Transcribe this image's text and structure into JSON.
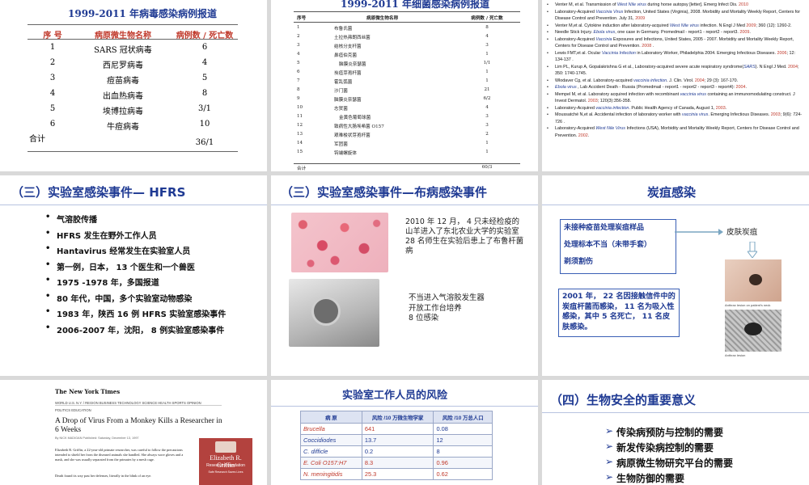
{
  "slide1": {
    "title": "1999-2011 年病毒感染病例报道",
    "headers": [
      "序 号",
      "病原微生物名称",
      "病例数 / 死亡数"
    ],
    "rows": [
      [
        "1",
        "SARS 冠状病毒",
        "6"
      ],
      [
        "2",
        "西尼罗病毒",
        "4"
      ],
      [
        "3",
        "痘苗病毒",
        "5"
      ],
      [
        "4",
        "出血热病毒",
        "8"
      ],
      [
        "5",
        "埃博拉病毒",
        "3/1"
      ],
      [
        "6",
        "牛痘病毒",
        "10"
      ]
    ],
    "total_label": "合计",
    "total_value": "36/1"
  },
  "slide2": {
    "title": "1999-2011 年细菌感染病例报道",
    "headers": [
      "序号",
      "病原微生物名称",
      "病例数 / 死亡数"
    ],
    "rows": [
      [
        "1",
        "布鲁氏菌",
        "8"
      ],
      [
        "2",
        "土拉热弗朗西丝菌",
        "4"
      ],
      [
        "3",
        "结核分支杆菌",
        "3"
      ],
      [
        "4",
        "鼻疽伯克菌",
        "1"
      ],
      [
        "5",
        "脑膜炎奈瑟菌",
        "1/1"
      ],
      [
        "6",
        "炭疽芽孢杆菌",
        "1"
      ],
      [
        "7",
        "霍乱弧菌",
        "1"
      ],
      [
        "8",
        "沙门菌",
        "21"
      ],
      [
        "9",
        "脑膜炎奈瑟菌",
        "6/2"
      ],
      [
        "10",
        "志贺菌",
        "4"
      ],
      [
        "11",
        "金黄色葡萄球菌",
        "3"
      ],
      [
        "12",
        "致病性大肠埃希菌 O157",
        "3"
      ],
      [
        "13",
        "艰难梭状芽孢杆菌",
        "2"
      ],
      [
        "14",
        "军团菌",
        "1"
      ],
      [
        "15",
        "钩端螺旋体",
        "1"
      ]
    ],
    "total_label": "合计",
    "total_value": "60/3"
  },
  "slide3": {
    "refs": [
      "Venter M, et al. Transmission of West Nile virus during horse autopsy [letter]. Emerg Infect Dis. 2010",
      "Laboratory-Acquired Vaccinia Virus Infection, United States (Virginia), 2008. Morbidity and Mortality Weekly Report, Centers for Disease Control and Prevention. July 31, 2009",
      "Venter M,et al. Cytokine induction after laboratory-acquired West Nile virus infection. N Engl J Med 2009; 360 (12): 1260-2.",
      "Needle Stick Injury. Ebola virus, one case in Germany. Promedmail - report1 - report2 - report3. 2009.",
      "Laboratory-Acquired Vaccinia Exposures and Infections, United States, 2005 - 2007. Morbidity and Mortality Weekly Report, Centers for Disease Control and Prevention. 2008 .",
      "Lewis FMT,et al. Ocular Vaccinia Infection in Laboratory Worker, Philadelphia 2004. Emerging Infectious Diseases. 2006; 12: 134-137 .",
      "Lim PL, Kurup A, Gopalakrishna G et al., Laboratory-acquired severe acute respiratory syndrome(SARS). N Engl J Med. 2004; 350: 1740-1745.",
      "Wlodaver Cg, et al. Laboratory-acquired vaccinia infection. J. Clin. Virol. 2004; 29 (3): 167-170.",
      "Ebola virus , Lab Accident Death - Russia (Promedmail - report1 - report2 - report3 - report4): 2004.",
      "Mempel M, et al. Laboratory acquired infection with recombinant vaccinia virus containing an immunomodulating construct. J Invest Dermatol. 2003; 120(3):356-358.",
      "Laboratory-Acquired vaccinia infection. Public Health Agency of Canada, August 1, 2003.",
      "Moussatché N,et al. Accidental infection of laboratory worker with vaccinia virus. Emerging Infectious Diseases. 2003; 9(6): 724-726 .",
      "Laboratory-Acquired West Nile Virus Infections (USA), Morbidity and Mortality Weekly Report, Centers for Disease Control and Prevention. 2002."
    ]
  },
  "slide4": {
    "title": "（三）实验室感染事件— HFRS",
    "bullets": [
      "气溶胶传播",
      "HFRS  发生在野外工作人员",
      "Hantavirus  经常发生在实验室人员",
      "第一例，日本， 13 个医生和一个兽医",
      "1975 -1978 年，多国报道",
      "80 年代，中国，多个实验室动物感染",
      "1983 年，陕西 16  例 HFRS 实验室感染事件",
      "2006-2007 年，沈阳， 8 例实验室感染事件"
    ]
  },
  "slide5": {
    "title": "（三）实验室感染事件—布病感染事件",
    "text1": "2010 年 12 月， 4 只未经检疫的山羊进入了东北农业大学的实验室\n28 名师生在实验后患上了布鲁杆菌病",
    "text2": "不当进入气溶胶发生器\n开放工作台培养\n8 位感染"
  },
  "slide6": {
    "title": "炭疽感染",
    "box_lines": [
      "未接种疫苗处理炭疽样品",
      "处理标本不当（未带手套）",
      "剃须割伤"
    ],
    "box2": "2001 年， 22 名因接触信件中的炭疽杆菌而感染， 11 名为吸入性感染，其中 5 名死亡， 11 名皮肤感染。",
    "skin_label": "皮肤炭疽",
    "cap1": "Anthrax lesion on patient's neck",
    "cap2": "Anthrax lesion"
  },
  "slide7": {
    "logo": "The New York Times",
    "nav": "WORLD   U.S.   N.Y. / REGION   BUSINESS   TECHNOLOGY   SCIENCE   HEALTH   SPORTS   OPINION",
    "nav2": "POLITICS    EDUCATION",
    "headline": "A Drop of Virus From a Monkey Kills a Researcher in 6 Weeks",
    "byline": "By NICK MADIGAN  Published: Saturday, December 13, 1997",
    "body": "Elizabeth R. Griffin, a 22-year-old primate researcher, was careful to follow the precautions intended to shield her from the diseased animals she handled. She always wore gloves and a mask, and she was usually separated from the primates by a mesh cage.",
    "body2": "Death found its way past her defenses, literally in the blink of an eye.",
    "badge_name": "Elizabeth R. Griffin",
    "badge_org": "Research Foundation",
    "badge_sub": "Safe Research Saves Lives"
  },
  "slide8": {
    "title": "实验室工作人员的风险",
    "headers": [
      "病  原",
      "风险 /10 万微生物学家",
      "风险 /10 万总人口"
    ],
    "rows": [
      [
        "Brucella",
        "641",
        "0.08"
      ],
      [
        "Coccidiodes",
        "13.7",
        "12"
      ],
      [
        "C. difficle",
        "0.2",
        "8"
      ],
      [
        "E. Coli O157:H7",
        "8.3",
        "0.96"
      ],
      [
        "N. meningitidis",
        "25.3",
        "0.62"
      ]
    ]
  },
  "slide9": {
    "title": "（四）生物安全的重要意义",
    "bullets": [
      "传染病预防与控制的需要",
      "新发传染病控制的需要",
      "病原微生物研究平台的需要",
      "生物防御的需要"
    ]
  }
}
